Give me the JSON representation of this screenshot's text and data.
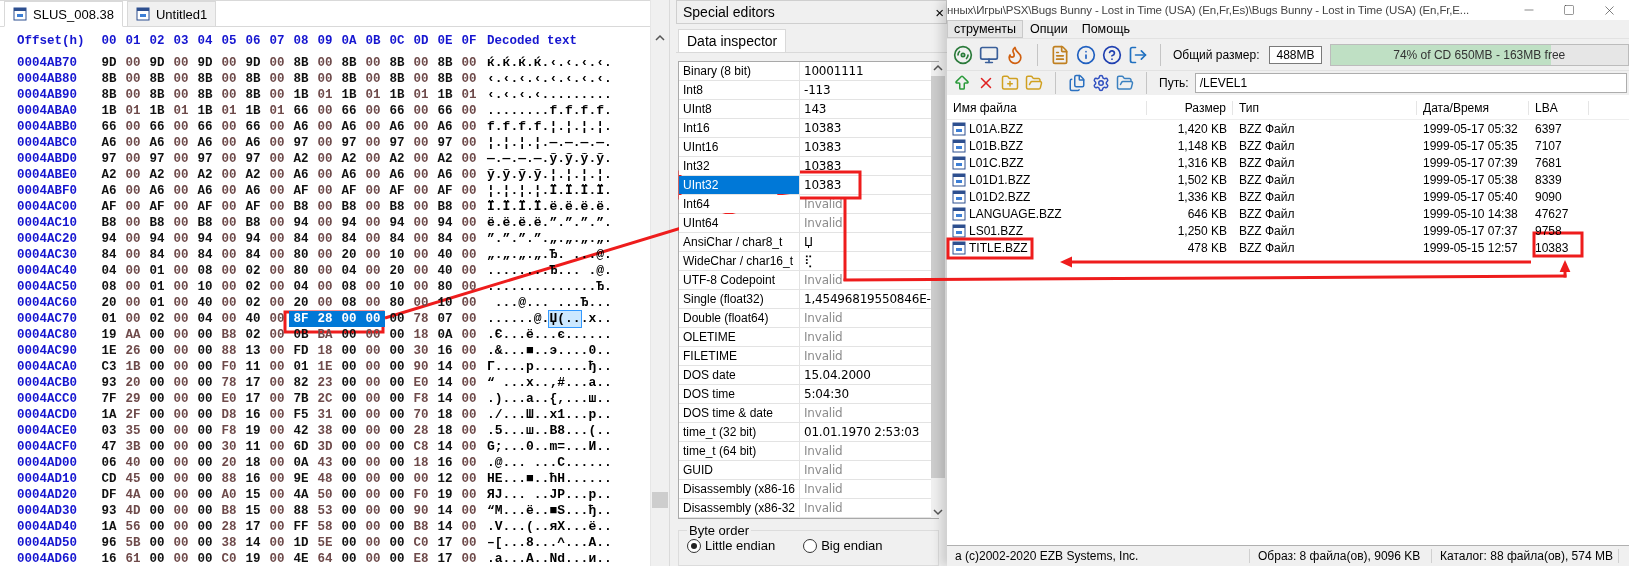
{
  "hex_editor": {
    "tabs": [
      {
        "label": "SLUS_008.38",
        "selected": true
      },
      {
        "label": "Untitled1",
        "selected": false
      }
    ],
    "header": {
      "offset": "Offset(h)",
      "columns": [
        "00",
        "01",
        "02",
        "03",
        "04",
        "05",
        "06",
        "07",
        "08",
        "09",
        "0A",
        "0B",
        "0C",
        "0D",
        "0E",
        "0F"
      ],
      "decoded": "Decoded text"
    },
    "rows": [
      {
        "offset": "0004AB70",
        "hex": [
          {
            "bytes": [
              "9D",
              "00",
              "9D",
              "00",
              "9D",
              "00",
              "9D",
              "00",
              "8B",
              "00",
              "8B",
              "00",
              "8B",
              "00",
              "8B",
              "00"
            ],
            "selected": false
          }
        ],
        "text": [
          {
            "t": "ќ.ќ.ќ.ќ.‹.‹.‹.‹.",
            "selected": false
          }
        ]
      },
      {
        "offset": "0004AB80",
        "hex": [
          {
            "bytes": [
              "8B",
              "00",
              "8B",
              "00",
              "8B",
              "00",
              "8B",
              "00",
              "8B",
              "00",
              "8B",
              "00",
              "8B",
              "00",
              "8B",
              "00"
            ],
            "selected": false
          }
        ],
        "text": [
          {
            "t": "‹.‹.‹.‹.‹.‹.‹.‹.",
            "selected": false
          }
        ]
      },
      {
        "offset": "0004AB90",
        "hex": [
          {
            "bytes": [
              "8B",
              "00",
              "8B",
              "00",
              "8B",
              "00",
              "8B",
              "00",
              "1B",
              "01",
              "1B",
              "01",
              "1B",
              "01",
              "1B",
              "01"
            ],
            "selected": false
          }
        ],
        "text": [
          {
            "t": "‹.‹.‹.‹.........",
            "selected": false
          }
        ]
      },
      {
        "offset": "0004ABA0",
        "hex": [
          {
            "bytes": [
              "1B",
              "01",
              "1B",
              "01",
              "1B",
              "01",
              "1B",
              "01",
              "66",
              "00",
              "66",
              "00",
              "66",
              "00",
              "66",
              "00"
            ],
            "selected": false
          }
        ],
        "text": [
          {
            "t": "........f.f.f.f.",
            "selected": false
          }
        ]
      },
      {
        "offset": "0004ABB0",
        "hex": [
          {
            "bytes": [
              "66",
              "00",
              "66",
              "00",
              "66",
              "00",
              "66",
              "00",
              "A6",
              "00",
              "A6",
              "00",
              "A6",
              "00",
              "A6",
              "00"
            ],
            "selected": false
          }
        ],
        "text": [
          {
            "t": "f.f.f.f.¦.¦.¦.¦.",
            "selected": false
          }
        ]
      },
      {
        "offset": "0004ABC0",
        "hex": [
          {
            "bytes": [
              "A6",
              "00",
              "A6",
              "00",
              "A6",
              "00",
              "A6",
              "00",
              "97",
              "00",
              "97",
              "00",
              "97",
              "00",
              "97",
              "00"
            ],
            "selected": false
          }
        ],
        "text": [
          {
            "t": "¦.¦.¦.¦.—.—.—.—.",
            "selected": false
          }
        ]
      },
      {
        "offset": "0004ABD0",
        "hex": [
          {
            "bytes": [
              "97",
              "00",
              "97",
              "00",
              "97",
              "00",
              "97",
              "00",
              "A2",
              "00",
              "A2",
              "00",
              "A2",
              "00",
              "A2",
              "00"
            ],
            "selected": false
          }
        ],
        "text": [
          {
            "t": "—.—.—.—.ў.ў.ў.ў.",
            "selected": false
          }
        ]
      },
      {
        "offset": "0004ABE0",
        "hex": [
          {
            "bytes": [
              "A2",
              "00",
              "A2",
              "00",
              "A2",
              "00",
              "A2",
              "00",
              "A6",
              "00",
              "A6",
              "00",
              "A6",
              "00",
              "A6",
              "00"
            ],
            "selected": false
          }
        ],
        "text": [
          {
            "t": "ў.ў.ў.ў.¦.¦.¦.¦.",
            "selected": false
          }
        ]
      },
      {
        "offset": "0004ABF0",
        "hex": [
          {
            "bytes": [
              "A6",
              "00",
              "A6",
              "00",
              "A6",
              "00",
              "A6",
              "00",
              "AF",
              "00",
              "AF",
              "00",
              "AF",
              "00",
              "AF",
              "00"
            ],
            "selected": false
          }
        ],
        "text": [
          {
            "t": "¦.¦.¦.¦.Ї.Ї.Ї.Ї.",
            "selected": false
          }
        ]
      },
      {
        "offset": "0004AC00",
        "hex": [
          {
            "bytes": [
              "AF",
              "00",
              "AF",
              "00",
              "AF",
              "00",
              "AF",
              "00",
              "B8",
              "00",
              "B8",
              "00",
              "B8",
              "00",
              "B8",
              "00"
            ],
            "selected": false
          }
        ],
        "text": [
          {
            "t": "Ї.Ї.Ї.Ї.ё.ё.ё.ё.",
            "selected": false
          }
        ]
      },
      {
        "offset": "0004AC10",
        "hex": [
          {
            "bytes": [
              "B8",
              "00",
              "B8",
              "00",
              "B8",
              "00",
              "B8",
              "00",
              "94",
              "00",
              "94",
              "00",
              "94",
              "00",
              "94",
              "00"
            ],
            "selected": false
          }
        ],
        "text": [
          {
            "t": "ё.ё.ё.ё.”.”.”.”.",
            "selected": false
          }
        ]
      },
      {
        "offset": "0004AC20",
        "hex": [
          {
            "bytes": [
              "94",
              "00",
              "94",
              "00",
              "94",
              "00",
              "94",
              "00",
              "84",
              "00",
              "84",
              "00",
              "84",
              "00",
              "84",
              "00"
            ],
            "selected": false
          }
        ],
        "text": [
          {
            "t": "”.”.”.”.„.„.„.„.",
            "selected": false
          }
        ]
      },
      {
        "offset": "0004AC30",
        "hex": [
          {
            "bytes": [
              "84",
              "00",
              "84",
              "00",
              "84",
              "00",
              "84",
              "00",
              "80",
              "00",
              "20",
              "00",
              "10",
              "00",
              "40",
              "00"
            ],
            "selected": false
          }
        ],
        "text": [
          {
            "t": "„.„.„.„.Ђ. ...@.",
            "selected": false
          }
        ]
      },
      {
        "offset": "0004AC40",
        "hex": [
          {
            "bytes": [
              "04",
              "00",
              "01",
              "00",
              "08",
              "00",
              "02",
              "00",
              "80",
              "00",
              "04",
              "00",
              "20",
              "00",
              "40",
              "00"
            ],
            "selected": false
          }
        ],
        "text": [
          {
            "t": "........Ђ... .@.",
            "selected": false
          }
        ]
      },
      {
        "offset": "0004AC50",
        "hex": [
          {
            "bytes": [
              "08",
              "00",
              "01",
              "00",
              "10",
              "00",
              "02",
              "00",
              "04",
              "00",
              "08",
              "00",
              "10",
              "00",
              "80",
              "00"
            ],
            "selected": false
          }
        ],
        "text": [
          {
            "t": "..............Ђ.",
            "selected": false
          }
        ]
      },
      {
        "offset": "0004AC60",
        "hex": [
          {
            "bytes": [
              "20",
              "00",
              "01",
              "00",
              "40",
              "00",
              "02",
              "00",
              "20",
              "00",
              "08",
              "00",
              "80",
              "00",
              "10",
              "00"
            ],
            "selected": false
          }
        ],
        "text": [
          {
            "t": " ...@... ...Ђ...",
            "selected": false
          }
        ]
      },
      {
        "offset": "0004AC70",
        "hex": [
          {
            "bytes": [
              "01",
              "00",
              "02",
              "00",
              "04",
              "00",
              "40",
              "00"
            ],
            "selected": false
          },
          {
            "bytes": [
              "8F",
              "28",
              "00",
              "00"
            ],
            "selected": true
          },
          {
            "bytes": [
              "00",
              "78",
              "07",
              "00"
            ],
            "selected": false
          }
        ],
        "text": [
          {
            "t": "......@.",
            "selected": false
          },
          {
            "t": "Џ(..",
            "selected": true
          },
          {
            "t": ".x..",
            "selected": false
          }
        ]
      },
      {
        "offset": "0004AC80",
        "hex": [
          {
            "bytes": [
              "19",
              "AA",
              "00",
              "00",
              "00",
              "B8",
              "02",
              "00",
              "0B",
              "BA",
              "00",
              "00",
              "00",
              "18",
              "0A",
              "00"
            ],
            "selected": false
          }
        ],
        "text": [
          {
            "t": ".Є...ё...є......",
            "selected": false
          }
        ]
      },
      {
        "offset": "0004AC90",
        "hex": [
          {
            "bytes": [
              "1E",
              "26",
              "00",
              "00",
              "00",
              "88",
              "13",
              "00",
              "FD",
              "18",
              "00",
              "00",
              "00",
              "30",
              "16",
              "00"
            ],
            "selected": false
          }
        ],
        "text": [
          {
            "t": ".&...■..э....0..",
            "selected": false
          }
        ]
      },
      {
        "offset": "0004ACA0",
        "hex": [
          {
            "bytes": [
              "C3",
              "1B",
              "00",
              "00",
              "00",
              "F0",
              "11",
              "00",
              "01",
              "1E",
              "00",
              "00",
              "00",
              "90",
              "14",
              "00"
            ],
            "selected": false
          }
        ],
        "text": [
          {
            "t": "Г....р.......ђ..",
            "selected": false
          }
        ]
      },
      {
        "offset": "0004ACB0",
        "hex": [
          {
            "bytes": [
              "93",
              "20",
              "00",
              "00",
              "00",
              "78",
              "17",
              "00",
              "82",
              "23",
              "00",
              "00",
              "00",
              "E0",
              "14",
              "00"
            ],
            "selected": false
          }
        ],
        "text": [
          {
            "t": "“ ...x..‚#...а..",
            "selected": false
          }
        ]
      },
      {
        "offset": "0004ACC0",
        "hex": [
          {
            "bytes": [
              "7F",
              "29",
              "00",
              "00",
              "00",
              "E0",
              "17",
              "00",
              "7B",
              "2C",
              "00",
              "00",
              "00",
              "F8",
              "14",
              "00"
            ],
            "selected": false
          }
        ],
        "text": [
          {
            "t": ".)...а..{,...ш..",
            "selected": false
          }
        ]
      },
      {
        "offset": "0004ACD0",
        "hex": [
          {
            "bytes": [
              "1A",
              "2F",
              "00",
              "00",
              "00",
              "D8",
              "16",
              "00",
              "F5",
              "31",
              "00",
              "00",
              "00",
              "70",
              "18",
              "00"
            ],
            "selected": false
          }
        ],
        "text": [
          {
            "t": "./...Ш..х1...p..",
            "selected": false
          }
        ]
      },
      {
        "offset": "0004ACE0",
        "hex": [
          {
            "bytes": [
              "03",
              "35",
              "00",
              "00",
              "00",
              "F8",
              "19",
              "00",
              "42",
              "38",
              "00",
              "00",
              "00",
              "28",
              "18",
              "00"
            ],
            "selected": false
          }
        ],
        "text": [
          {
            "t": ".5...ш..B8...(..",
            "selected": false
          }
        ]
      },
      {
        "offset": "0004ACF0",
        "hex": [
          {
            "bytes": [
              "47",
              "3B",
              "00",
              "00",
              "00",
              "30",
              "11",
              "00",
              "6D",
              "3D",
              "00",
              "00",
              "00",
              "C8",
              "14",
              "00"
            ],
            "selected": false
          }
        ],
        "text": [
          {
            "t": "G;...0..m=...И..",
            "selected": false
          }
        ]
      },
      {
        "offset": "0004AD00",
        "hex": [
          {
            "bytes": [
              "06",
              "40",
              "00",
              "00",
              "00",
              "20",
              "18",
              "00",
              "0A",
              "43",
              "00",
              "00",
              "00",
              "18",
              "16",
              "00"
            ],
            "selected": false
          }
        ],
        "text": [
          {
            "t": ".@... ...C......",
            "selected": false
          }
        ]
      },
      {
        "offset": "0004AD10",
        "hex": [
          {
            "bytes": [
              "CD",
              "45",
              "00",
              "00",
              "00",
              "88",
              "16",
              "00",
              "9E",
              "48",
              "00",
              "00",
              "00",
              "00",
              "12",
              "00"
            ],
            "selected": false
          }
        ],
        "text": [
          {
            "t": "НE...■..ћH......",
            "selected": false
          }
        ]
      },
      {
        "offset": "0004AD20",
        "hex": [
          {
            "bytes": [
              "DF",
              "4A",
              "00",
              "00",
              "00",
              "A0",
              "15",
              "00",
              "4A",
              "50",
              "00",
              "00",
              "00",
              "F0",
              "19",
              "00"
            ],
            "selected": false
          }
        ],
        "text": [
          {
            "t": "ЯJ... ..JP...р..",
            "selected": false
          }
        ]
      },
      {
        "offset": "0004AD30",
        "hex": [
          {
            "bytes": [
              "93",
              "4D",
              "00",
              "00",
              "00",
              "B8",
              "15",
              "00",
              "88",
              "53",
              "00",
              "00",
              "00",
              "90",
              "14",
              "00"
            ],
            "selected": false
          }
        ],
        "text": [
          {
            "t": "“M...ё..■S...ђ..",
            "selected": false
          }
        ]
      },
      {
        "offset": "0004AD40",
        "hex": [
          {
            "bytes": [
              "1A",
              "56",
              "00",
              "00",
              "00",
              "28",
              "17",
              "00",
              "FF",
              "58",
              "00",
              "00",
              "00",
              "B8",
              "14",
              "00"
            ],
            "selected": false
          }
        ],
        "text": [
          {
            "t": ".V...(..яX...ё..",
            "selected": false
          }
        ]
      },
      {
        "offset": "0004AD50",
        "hex": [
          {
            "bytes": [
              "96",
              "5B",
              "00",
              "00",
              "00",
              "38",
              "14",
              "00",
              "1D",
              "5E",
              "00",
              "00",
              "00",
              "C0",
              "17",
              "00"
            ],
            "selected": false
          }
        ],
        "text": [
          {
            "t": "–[...8...^...А..",
            "selected": false
          }
        ]
      },
      {
        "offset": "0004AD60",
        "hex": [
          {
            "bytes": [
              "16",
              "61",
              "00",
              "00",
              "00",
              "C0",
              "19",
              "00",
              "4E",
              "64",
              "00",
              "00",
              "00",
              "E8",
              "17",
              "00"
            ],
            "selected": false
          }
        ],
        "text": [
          {
            "t": ".a...А..Nd...и..",
            "selected": false
          }
        ]
      }
    ]
  },
  "special_editors": {
    "title": "Special editors",
    "close": "×",
    "tabs": [
      {
        "label": "Data inspector",
        "selected": true
      }
    ],
    "rows": [
      {
        "label": "Binary (8 bit)",
        "value": "10001111",
        "invalid": false,
        "selected": false
      },
      {
        "label": "Int8",
        "value": "-113",
        "invalid": false,
        "selected": false
      },
      {
        "label": "UInt8",
        "value": "143",
        "invalid": false,
        "selected": false
      },
      {
        "label": "Int16",
        "value": "10383",
        "invalid": false,
        "selected": false
      },
      {
        "label": "UInt16",
        "value": "10383",
        "invalid": false,
        "selected": false
      },
      {
        "label": "Int32",
        "value": "10383",
        "invalid": false,
        "selected": false
      },
      {
        "label": "UInt32",
        "value": "10383",
        "invalid": false,
        "selected": true
      },
      {
        "label": "Int64",
        "value": "Invalid",
        "invalid": true,
        "selected": false
      },
      {
        "label": "UInt64",
        "value": "Invalid",
        "invalid": true,
        "selected": false
      },
      {
        "label": "AnsiChar / char8_t",
        "value": "Џ",
        "invalid": false,
        "selected": false
      },
      {
        "label": "WideChar / char16_t",
        "value": "⢏",
        "invalid": false,
        "selected": false
      },
      {
        "label": "UTF-8 Codepoint",
        "value": "Invalid",
        "invalid": true,
        "selected": false
      },
      {
        "label": "Single (float32)",
        "value": "1,45496819550846E-",
        "invalid": false,
        "selected": false
      },
      {
        "label": "Double (float64)",
        "value": "Invalid",
        "invalid": true,
        "selected": false
      },
      {
        "label": "OLETIME",
        "value": "Invalid",
        "invalid": true,
        "selected": false
      },
      {
        "label": "FILETIME",
        "value": "Invalid",
        "invalid": true,
        "selected": false
      },
      {
        "label": "DOS date",
        "value": "15.04.2000",
        "invalid": false,
        "selected": false
      },
      {
        "label": "DOS time",
        "value": "5:04:30",
        "invalid": false,
        "selected": false
      },
      {
        "label": "DOS time & date",
        "value": "Invalid",
        "invalid": true,
        "selected": false
      },
      {
        "label": "time_t (32 bit)",
        "value": "01.01.1970 2:53:03",
        "invalid": false,
        "selected": false
      },
      {
        "label": "time_t (64 bit)",
        "value": "Invalid",
        "invalid": true,
        "selected": false
      },
      {
        "label": "GUID",
        "value": "Invalid",
        "invalid": true,
        "selected": false
      },
      {
        "label": "Disassembly (x86-16",
        "value": "Invalid",
        "invalid": true,
        "selected": false
      },
      {
        "label": "Disassembly (x86-32",
        "value": "Invalid",
        "invalid": true,
        "selected": false
      }
    ],
    "byte_order": {
      "title": "Byte order",
      "options": [
        {
          "label": "Little endian",
          "selected": true
        },
        {
          "label": "Big endian",
          "selected": false
        }
      ]
    }
  },
  "iso_window": {
    "title": "нных\\Игры\\PSX\\Bugs Bunny - Lost in Time (USA) (En,Fr,Es)\\Bugs Bunny - Lost in Time (USA) (En,Fr,E...",
    "menu": [
      {
        "label": "струменты",
        "selected": true
      },
      {
        "label": "Опции",
        "selected": false
      },
      {
        "label": "Помощь",
        "selected": false
      }
    ],
    "total_size_label": "Общий размер:",
    "total_size": "488MB",
    "capacity": {
      "level": 0.74,
      "text": "74% of CD 650MB - 163MB free"
    },
    "path_label": "Путь:",
    "path": "/LEVEL1",
    "columns": [
      "Имя файла",
      "Размер",
      "Тип",
      "Дата/Время",
      "LBA"
    ],
    "files": [
      {
        "name": "L01A.BZZ",
        "size": "1,420 KB",
        "type": "BZZ Файл",
        "date": "1999-05-17 05:32",
        "lba": "6397"
      },
      {
        "name": "L01B.BZZ",
        "size": "1,148 KB",
        "type": "BZZ Файл",
        "date": "1999-05-17 05:35",
        "lba": "7107"
      },
      {
        "name": "L01C.BZZ",
        "size": "1,316 KB",
        "type": "BZZ Файл",
        "date": "1999-05-17 07:39",
        "lba": "7681"
      },
      {
        "name": "L01D1.BZZ",
        "size": "1,502 KB",
        "type": "BZZ Файл",
        "date": "1999-05-17 05:38",
        "lba": "8339"
      },
      {
        "name": "L01D2.BZZ",
        "size": "1,336 KB",
        "type": "BZZ Файл",
        "date": "1999-05-17 05:40",
        "lba": "9090"
      },
      {
        "name": "LANGUAGE.BZZ",
        "size": "646 KB",
        "type": "BZZ Файл",
        "date": "1999-05-10 14:38",
        "lba": "47627"
      },
      {
        "name": "LS01.BZZ",
        "size": "1,250 KB",
        "type": "BZZ Файл",
        "date": "1999-05-17 07:37",
        "lba": "9758"
      },
      {
        "name": "TITLE.BZZ",
        "size": "478 KB",
        "type": "BZZ Файл",
        "date": "1999-05-15 12:57",
        "lba": "10383"
      }
    ],
    "status_bar": [
      "а (c)2002-2020 EZB Systems, Inc.",
      "Образ: 8 файла(ов), 9096 KB",
      "Каталог: 88 файла(ов), 574 MB"
    ]
  }
}
